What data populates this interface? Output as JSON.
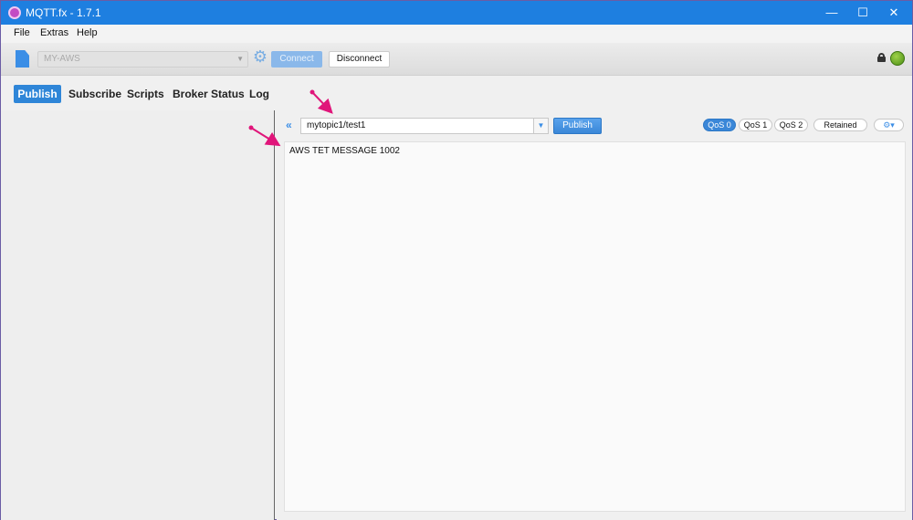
{
  "window": {
    "title": "MQTT.fx - 1.7.1"
  },
  "menu": {
    "file": "File",
    "extras": "Extras",
    "help": "Help"
  },
  "toolbar": {
    "profile": "MY-AWS",
    "connect_label": "Connect",
    "disconnect_label": "Disconnect"
  },
  "tabs": [
    {
      "label": "Publish",
      "active": true
    },
    {
      "label": "Subscribe"
    },
    {
      "label": "Scripts"
    },
    {
      "label": "Broker Status"
    },
    {
      "label": "Log"
    }
  ],
  "publish": {
    "topic": "mytopic1/test1",
    "publish_label": "Publish",
    "qos": [
      "QoS 0",
      "QoS 1",
      "QoS 2"
    ],
    "selected_qos": "QoS 0",
    "retained_label": "Retained",
    "payload": "AWS TET MESSAGE 1002"
  },
  "colors": {
    "titlebar": "#1e7fe0",
    "accent": "#2f86d8",
    "annotation": "#e0157a",
    "connected": "#6ab02a"
  },
  "icons": {
    "app": "mqttfx-app-icon",
    "document": "document-icon",
    "settings": "gear-icon",
    "lock": "lock-icon",
    "status": "connection-status-icon",
    "collapse": "double-chevron-left-icon",
    "dropdown": "chevron-down-icon",
    "options": "gear-dropdown-icon"
  }
}
